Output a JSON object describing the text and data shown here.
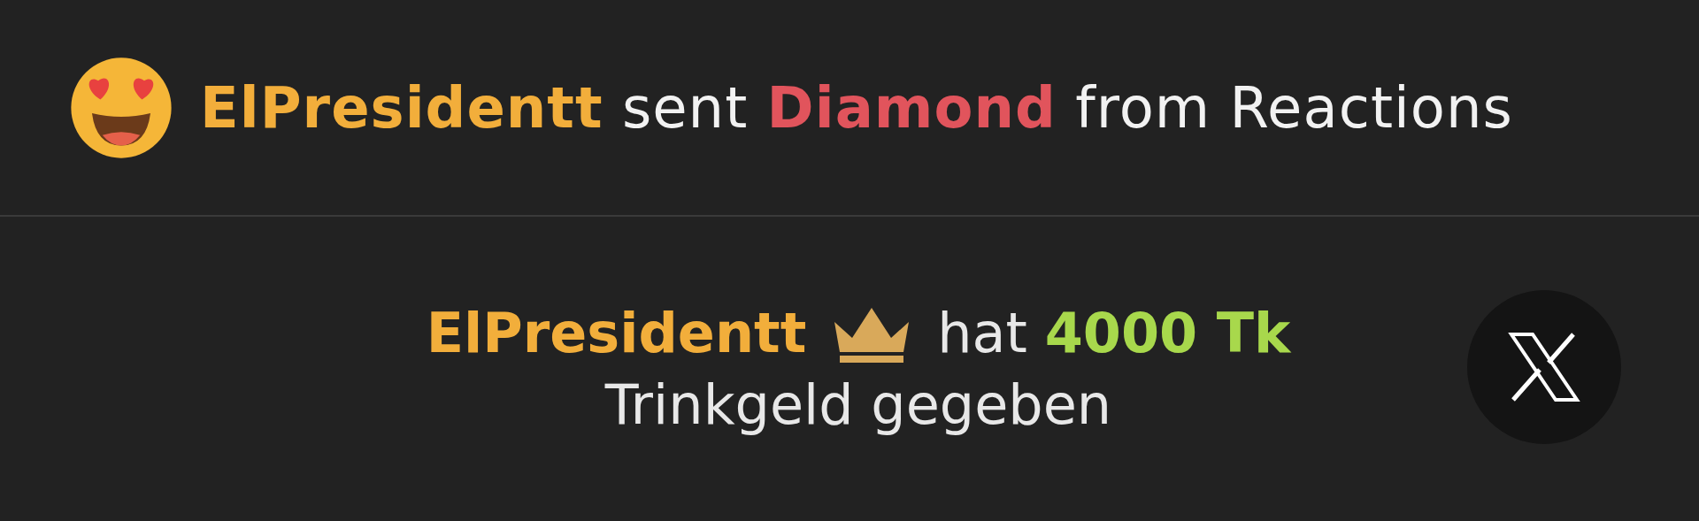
{
  "reaction": {
    "username": "ElPresidentt",
    "verb": "sent",
    "item": "Diamond",
    "source": "from Reactions"
  },
  "tip": {
    "username": "ElPresidentt",
    "action": "hat",
    "amount": "4000 Tk",
    "note": "Trinkgeld gegeben"
  }
}
